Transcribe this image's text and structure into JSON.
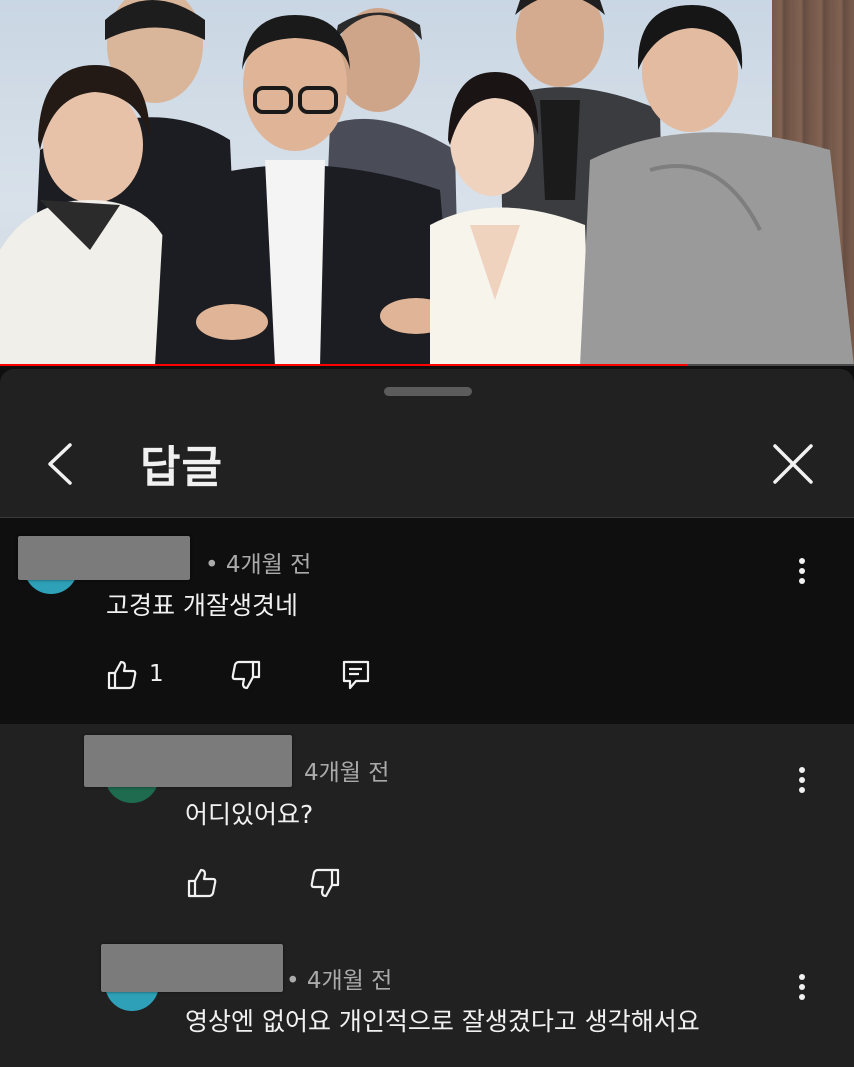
{
  "video": {
    "progress_fraction": 0.805
  },
  "panel": {
    "title": "답글"
  },
  "comments": [
    {
      "meta": "• 4개월 전",
      "text": "고경표 개잘생겻네",
      "like_count": "1",
      "avatar_color": "#2ea1b8"
    },
    {
      "meta": "4개월 전",
      "text": "어디있어요?",
      "like_count": "",
      "avatar_color": "#1e6b4f"
    },
    {
      "meta": "• 4개월 전",
      "text": "영상엔 없어요  개인적으로 잘생겼다고 생각해서요",
      "like_count": "",
      "avatar_color": "#2ea1b8"
    }
  ],
  "icons": {
    "back": "chevron-left-icon",
    "close": "close-icon",
    "more": "more-vert-icon",
    "like": "thumb-up-icon",
    "dislike": "thumb-down-icon",
    "reply": "reply-icon"
  },
  "colors": {
    "panel_bg": "#212121",
    "highlight_bg": "#0f0f0f",
    "progress": "#ff0000",
    "meta_text": "#aaaaaa"
  }
}
